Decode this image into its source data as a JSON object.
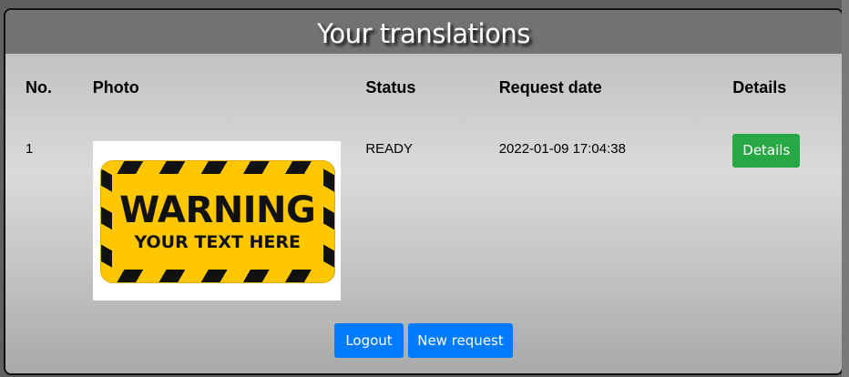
{
  "header": {
    "title": "Your translations"
  },
  "table": {
    "columns": [
      "No.",
      "Photo",
      "Status",
      "Request date",
      "Details"
    ],
    "rows": [
      {
        "no": "1",
        "photo": {
          "title": "WARNING",
          "subtitle": "YOUR TEXT HERE"
        },
        "status": "READY",
        "date": "2022-01-09 17:04:38",
        "details_label": "Details"
      }
    ]
  },
  "footer": {
    "logout_label": "Logout",
    "new_request_label": "New request"
  },
  "colors": {
    "details_button": "#28a745",
    "primary_button": "#007bff",
    "sign_yellow": "#ffc700"
  }
}
